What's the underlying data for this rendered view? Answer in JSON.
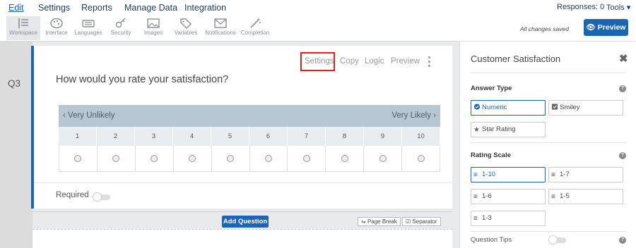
{
  "menu": {
    "items": [
      "Edit",
      "Settings",
      "Reports",
      "Manage Data",
      "Integration"
    ],
    "responses": "Responses: 0",
    "tools": "Tools ▾"
  },
  "toolbar": {
    "tools": [
      "Workspace",
      "Interface",
      "Languages",
      "Security",
      "Images",
      "Variables",
      "Notifications",
      "Completion"
    ],
    "saved_text": "All changes saved",
    "preview_label": "Preview"
  },
  "question": {
    "number": "Q3",
    "actions": [
      "Settings",
      "Copy",
      "Logic",
      "Preview"
    ],
    "text": "How would you rate your satisfaction?",
    "left_anchor": "Very Unlikely",
    "right_anchor": "Very Likely",
    "scale": [
      "1",
      "2",
      "3",
      "4",
      "5",
      "6",
      "7",
      "8",
      "9",
      "10"
    ],
    "required_label": "Required"
  },
  "addbar": {
    "add_label": "Add Question",
    "page_break": "Page Break",
    "separator": "Separator"
  },
  "panel": {
    "title": "Customer Satisfaction",
    "answer_type_label": "Answer Type",
    "answer_types": [
      "Numeric",
      "Smiley",
      "Star Rating"
    ],
    "rating_scale_label": "Rating Scale",
    "rating_scales": [
      "1-10",
      "1-7",
      "1-6",
      "1-5",
      "1-3"
    ],
    "question_tips_label": "Question Tips"
  },
  "colors": {
    "accent": "#1a66b3",
    "highlight": "#e02020"
  }
}
